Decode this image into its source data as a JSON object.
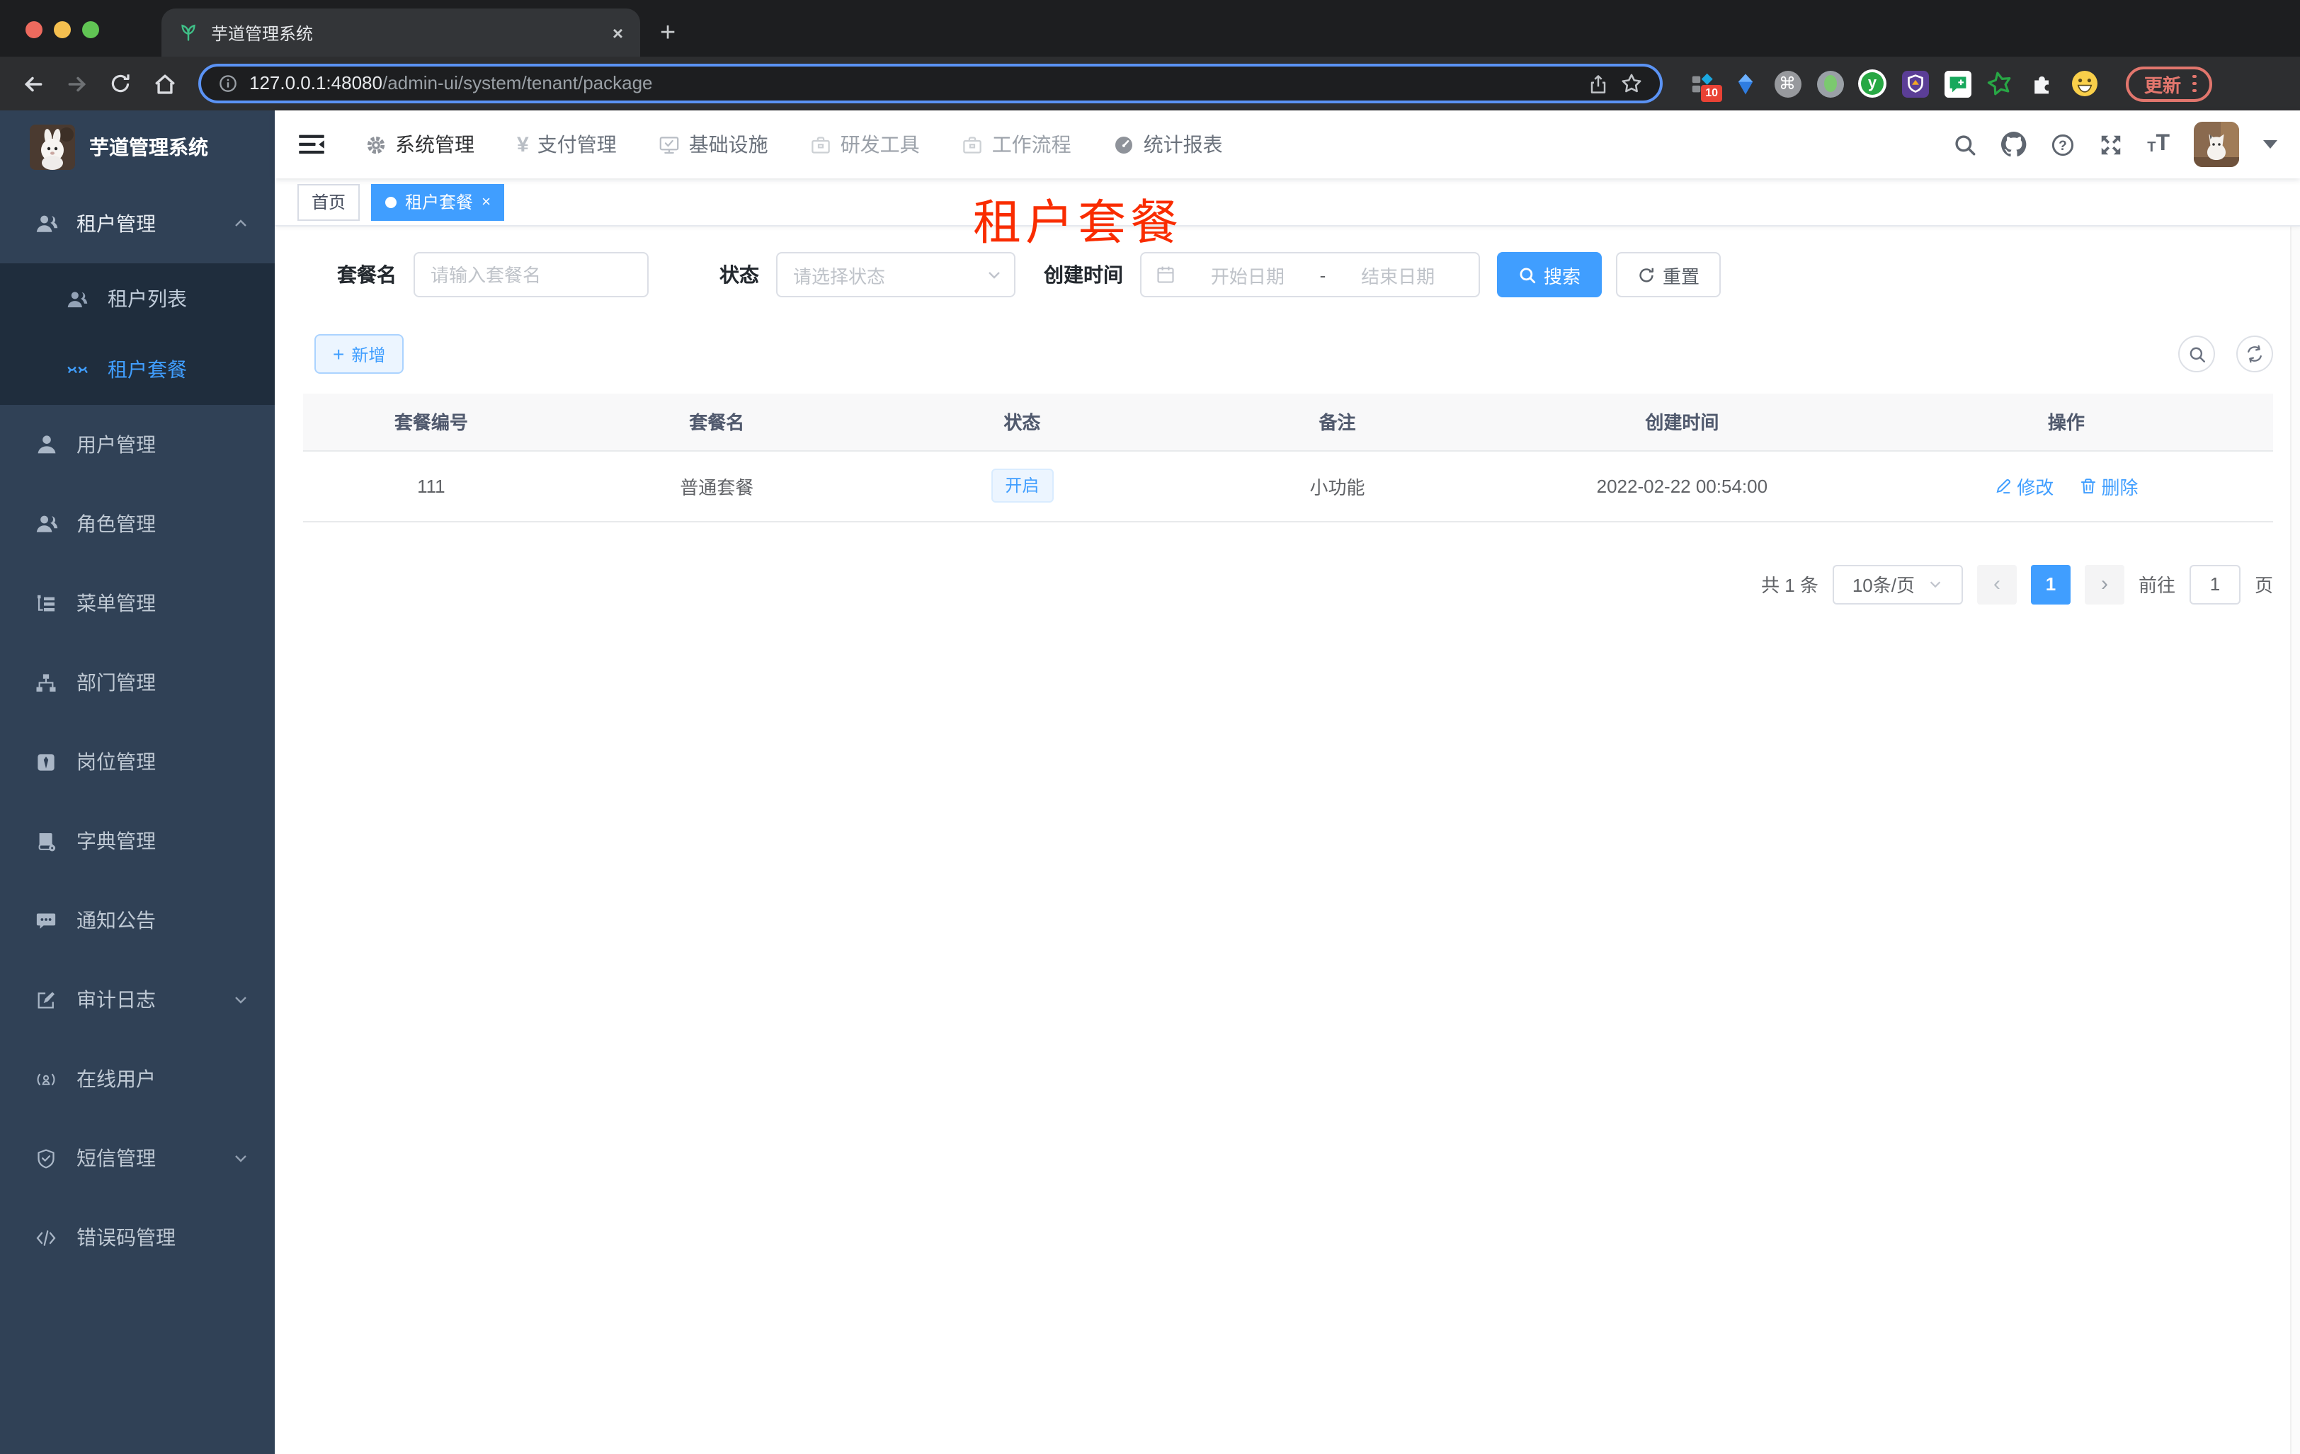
{
  "browser": {
    "tab_title": "芋道管理系统",
    "url_host": "127.0.0.1:48080",
    "url_path": "/admin-ui/system/tenant/package",
    "ext_badge": "10",
    "update_label": "更新"
  },
  "icons": {
    "plus": "+",
    "close": "×",
    "prev": "‹",
    "next": "›",
    "cmd": "⌘",
    "y": "y"
  },
  "header": {
    "nav": [
      "系统管理",
      "支付管理",
      "基础设施",
      "研发工具",
      "工作流程",
      "统计报表"
    ]
  },
  "sidebar": {
    "logo_title": "芋道管理系统",
    "group_label": "租户管理",
    "sub_items": [
      "租户列表",
      "租户套餐"
    ],
    "items": [
      "用户管理",
      "角色管理",
      "菜单管理",
      "部门管理",
      "岗位管理",
      "字典管理",
      "通知公告",
      "审计日志",
      "在线用户",
      "短信管理",
      "错误码管理"
    ]
  },
  "tags": {
    "home": "首页",
    "active": "租户套餐"
  },
  "annotation": {
    "text": "租户套餐",
    "color": "#f92c00"
  },
  "filters": {
    "name_label": "套餐名",
    "name_placeholder": "请输入套餐名",
    "status_label": "状态",
    "status_placeholder": "请选择状态",
    "date_label": "创建时间",
    "date_start": "开始日期",
    "date_sep": "-",
    "date_end": "结束日期",
    "search": "搜索",
    "reset": "重置"
  },
  "toolbar": {
    "add": "新增"
  },
  "table": {
    "columns": [
      "套餐编号",
      "套餐名",
      "状态",
      "备注",
      "创建时间",
      "操作"
    ],
    "row": {
      "id": "111",
      "name": "普通套餐",
      "status": "开启",
      "remark": "小功能",
      "created": "2022-02-22 00:54:00",
      "edit": "修改",
      "delete": "删除"
    }
  },
  "pagination": {
    "total": "共 1 条",
    "size": "10条/页",
    "page": "1",
    "goto": "前往",
    "goto_value": "1",
    "unit": "页"
  },
  "colors": {
    "primary": "#409eff",
    "sidebar": "#304156",
    "submenu": "#1f2d3d"
  }
}
